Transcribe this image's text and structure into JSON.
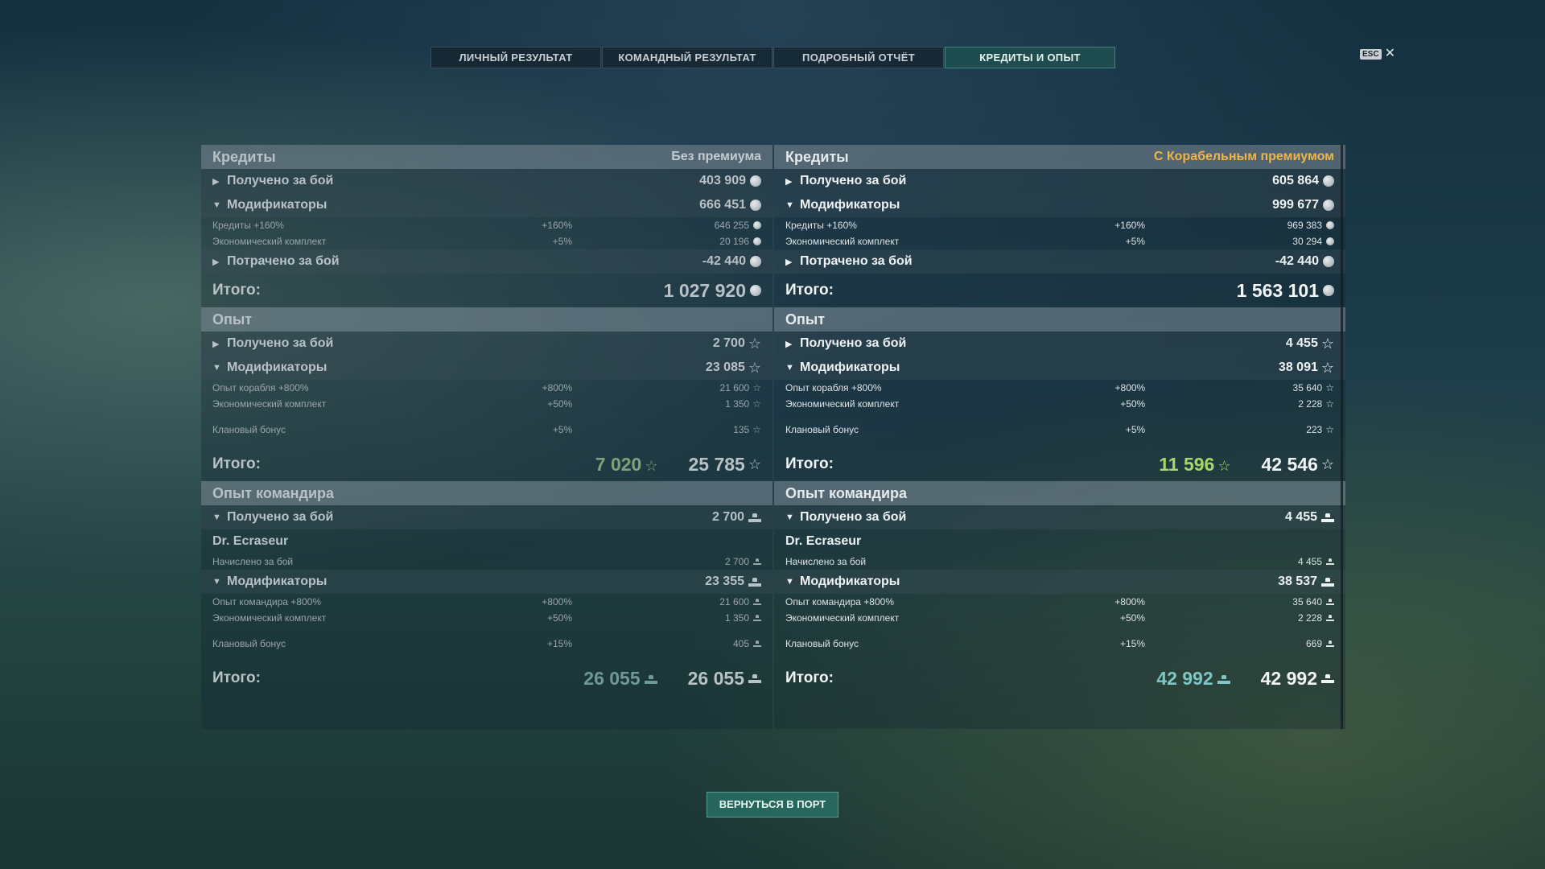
{
  "tabs": [
    "ЛИЧНЫЙ РЕЗУЛЬТАТ",
    "КОМАНДНЫЙ РЕЗУЛЬТАТ",
    "ПОДРОБНЫЙ ОТЧЁТ",
    "КРЕДИТЫ И ОПЫТ"
  ],
  "esc_label": "ESC",
  "left": {
    "credits_title": "Кредиты",
    "premium_label": "Без премиума",
    "credits_earned_label": "Получено за бой",
    "credits_earned": "403 909",
    "credits_mod_label": "Модификаторы",
    "credits_mod": "666 451",
    "credits_sub1_label": "Кредиты +160%",
    "credits_sub1_pct": "+160%",
    "credits_sub1_val": "646 255",
    "credits_sub2_label": "Экономический комплект",
    "credits_sub2_pct": "+5%",
    "credits_sub2_val": "20 196",
    "credits_spent_label": "Потрачено за бой",
    "credits_spent": "-42 440",
    "credits_total_label": "Итого:",
    "credits_total": "1 027 920",
    "xp_title": "Опыт",
    "xp_earned_label": "Получено за бой",
    "xp_earned": "2 700",
    "xp_mod_label": "Модификаторы",
    "xp_mod": "23 085",
    "xp_sub1_label": "Опыт корабля +800%",
    "xp_sub1_pct": "+800%",
    "xp_sub1_val": "21 600",
    "xp_sub2_label": "Экономический комплект",
    "xp_sub2_pct": "+50%",
    "xp_sub2_val": "1 350",
    "xp_sub3_label": "Клановый бонус",
    "xp_sub3_pct": "+5%",
    "xp_sub3_val": "135",
    "xp_total_label": "Итого:",
    "xp_total_free": "7 020",
    "xp_total": "25 785",
    "cmd_title": "Опыт командира",
    "cmd_earned_label": "Получено за бой",
    "cmd_earned": "2 700",
    "cmd_name": "Dr. Ecraseur",
    "cmd_accrued_label": "Начислено за бой",
    "cmd_accrued": "2 700",
    "cmd_mod_label": "Модификаторы",
    "cmd_mod": "23 355",
    "cmd_sub1_label": "Опыт командира +800%",
    "cmd_sub1_pct": "+800%",
    "cmd_sub1_val": "21 600",
    "cmd_sub2_label": "Экономический комплект",
    "cmd_sub2_pct": "+50%",
    "cmd_sub2_val": "1 350",
    "cmd_sub3_label": "Клановый бонус",
    "cmd_sub3_pct": "+15%",
    "cmd_sub3_val": "405",
    "cmd_total_label": "Итого:",
    "cmd_total_a": "26 055",
    "cmd_total_b": "26 055"
  },
  "right": {
    "credits_title": "Кредиты",
    "premium_label": "С Корабельным премиумом",
    "credits_earned_label": "Получено за бой",
    "credits_earned": "605 864",
    "credits_mod_label": "Модификаторы",
    "credits_mod": "999 677",
    "credits_sub1_label": "Кредиты +160%",
    "credits_sub1_pct": "+160%",
    "credits_sub1_val": "969 383",
    "credits_sub2_label": "Экономический комплект",
    "credits_sub2_pct": "+5%",
    "credits_sub2_val": "30 294",
    "credits_spent_label": "Потрачено за бой",
    "credits_spent": "-42 440",
    "credits_total_label": "Итого:",
    "credits_total": "1 563 101",
    "xp_title": "Опыт",
    "xp_earned_label": "Получено за бой",
    "xp_earned": "4 455",
    "xp_mod_label": "Модификаторы",
    "xp_mod": "38 091",
    "xp_sub1_label": "Опыт корабля +800%",
    "xp_sub1_pct": "+800%",
    "xp_sub1_val": "35 640",
    "xp_sub2_label": "Экономический комплект",
    "xp_sub2_pct": "+50%",
    "xp_sub2_val": "2 228",
    "xp_sub3_label": "Клановый бонус",
    "xp_sub3_pct": "+5%",
    "xp_sub3_val": "223",
    "xp_total_label": "Итого:",
    "xp_total_free": "11 596",
    "xp_total": "42 546",
    "cmd_title": "Опыт командира",
    "cmd_earned_label": "Получено за бой",
    "cmd_earned": "4 455",
    "cmd_name": "Dr. Ecraseur",
    "cmd_accrued_label": "Начислено за бой",
    "cmd_accrued": "4 455",
    "cmd_mod_label": "Модификаторы",
    "cmd_mod": "38 537",
    "cmd_sub1_label": "Опыт командира +800%",
    "cmd_sub1_pct": "+800%",
    "cmd_sub1_val": "35 640",
    "cmd_sub2_label": "Экономический комплект",
    "cmd_sub2_pct": "+50%",
    "cmd_sub2_val": "2 228",
    "cmd_sub3_label": "Клановый бонус",
    "cmd_sub3_pct": "+15%",
    "cmd_sub3_val": "669",
    "cmd_total_label": "Итого:",
    "cmd_total_a": "42 992",
    "cmd_total_b": "42 992"
  },
  "return_button": "ВЕРНУТЬСЯ В ПОРТ",
  "icons": {
    "credits": "credits-coin-icon",
    "xp": "xp-star-icon",
    "commander_xp": "commander-cap-icon",
    "expand": "chevron-right-icon",
    "collapse": "chevron-down-icon"
  },
  "colors": {
    "premium": "#f0b54a",
    "free_xp": "#a9d66a",
    "commander_xp": "#7ec7c7",
    "active_tab": "#1e5050"
  }
}
